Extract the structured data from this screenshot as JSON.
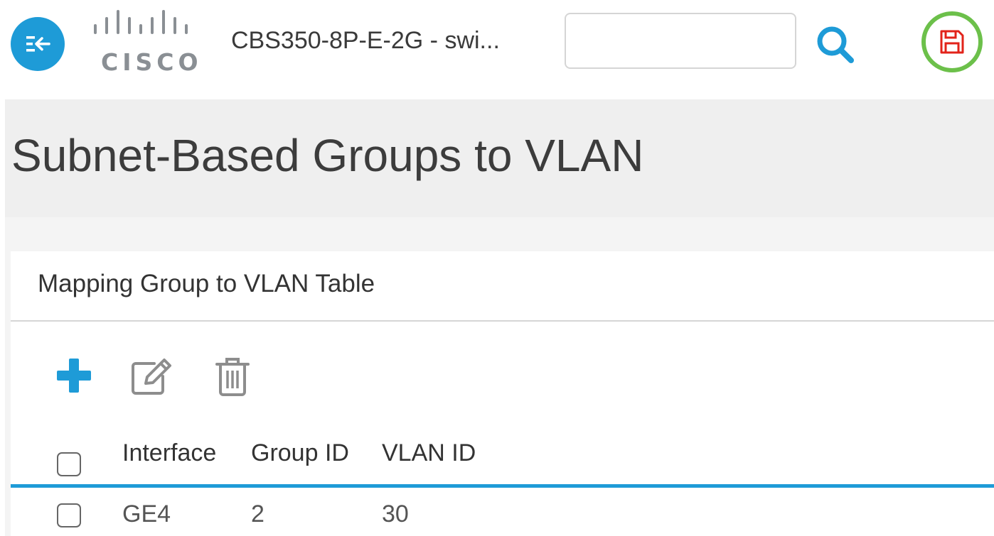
{
  "header": {
    "device_name": "CBS350-8P-E-2G - swi...",
    "logo_text": "CISCO",
    "search": {
      "value": "",
      "placeholder": ""
    },
    "icons": {
      "menu": "collapse-menu-icon",
      "search": "search-icon",
      "save": "save-icon"
    },
    "colors": {
      "accent": "#1e9bd7",
      "save_ring": "#6cc04a",
      "save_icon": "#e2231a"
    }
  },
  "page": {
    "title": "Subnet-Based Groups to VLAN"
  },
  "table_card": {
    "title": "Mapping Group to VLAN Table",
    "toolbar": {
      "add_icon": "plus-icon",
      "edit_icon": "edit-icon",
      "delete_icon": "trash-icon"
    },
    "columns": [
      "Interface",
      "Group ID",
      "VLAN ID"
    ],
    "rows": [
      {
        "interface": "GE4",
        "group_id": "2",
        "vlan_id": "30",
        "checked": false
      }
    ]
  }
}
